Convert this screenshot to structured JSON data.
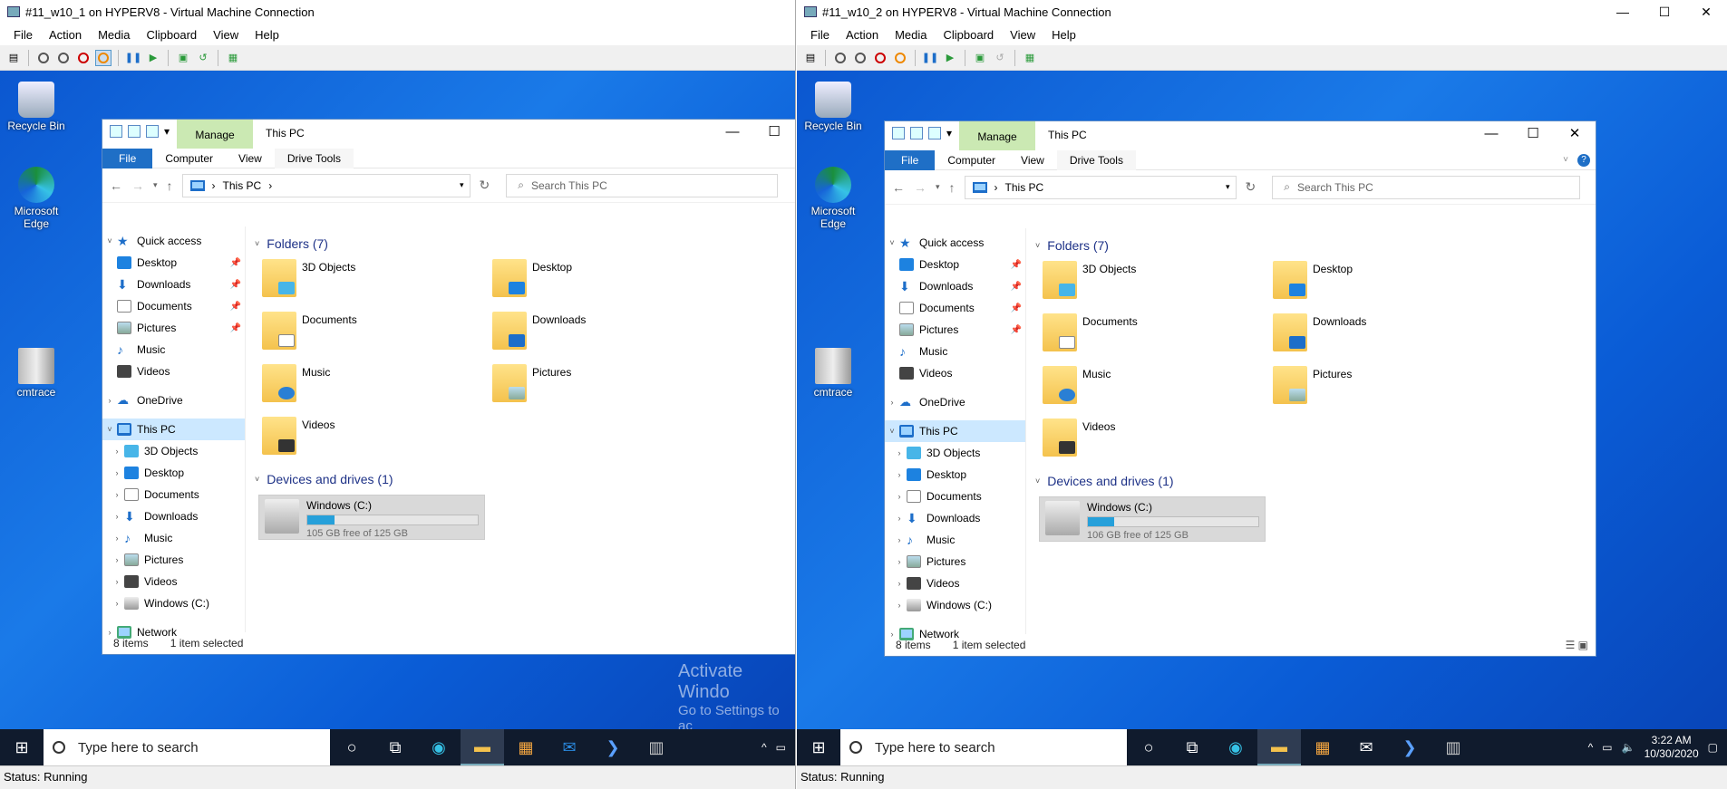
{
  "vm1": {
    "title": "#11_w10_1 on HYPERV8 - Virtual Machine Connection",
    "status": "Status: Running",
    "watermark_title": "Activate Windo",
    "watermark_sub": "Go to Settings to ac"
  },
  "vm2": {
    "title": "#11_w10_2 on HYPERV8 - Virtual Machine Connection",
    "status": "Status: Running",
    "clock_time": "3:22 AM",
    "clock_date": "10/30/2020"
  },
  "menu": [
    "File",
    "Action",
    "Media",
    "Clipboard",
    "View",
    "Help"
  ],
  "window_buttons": {
    "min": "—",
    "max": "☐",
    "close": "✕"
  },
  "desktop": {
    "recycle_bin": "Recycle Bin",
    "edge": "Microsoft Edge",
    "cmtrace": "cmtrace"
  },
  "taskbar": {
    "search_placeholder": "Type here to search"
  },
  "explorer": {
    "title": "This PC",
    "manage": "Manage",
    "tabs": {
      "file": "File",
      "computer": "Computer",
      "view": "View",
      "drive_tools": "Drive Tools"
    },
    "address": "This PC",
    "search_placeholder": "Search This PC",
    "quick_access": "Quick access",
    "onedrive": "OneDrive",
    "this_pc": "This PC",
    "network": "Network",
    "qa_items": [
      "Desktop",
      "Downloads",
      "Documents",
      "Pictures",
      "Music",
      "Videos"
    ],
    "pc_items": [
      "3D Objects",
      "Desktop",
      "Documents",
      "Downloads",
      "Music",
      "Pictures",
      "Videos",
      "Windows (C:)"
    ],
    "folders_header": "Folders (7)",
    "folders": [
      "3D Objects",
      "Desktop",
      "Documents",
      "Downloads",
      "Music",
      "Pictures",
      "Videos"
    ],
    "devices_header": "Devices and drives (1)",
    "drive_name": "Windows (C:)",
    "items_count": "8 items",
    "selected_count": "1 item selected"
  },
  "drive1": {
    "free": "105 GB free of 125 GB",
    "used_fraction": 0.16
  },
  "drive2": {
    "free": "106 GB free of 125 GB",
    "used_fraction": 0.152
  }
}
